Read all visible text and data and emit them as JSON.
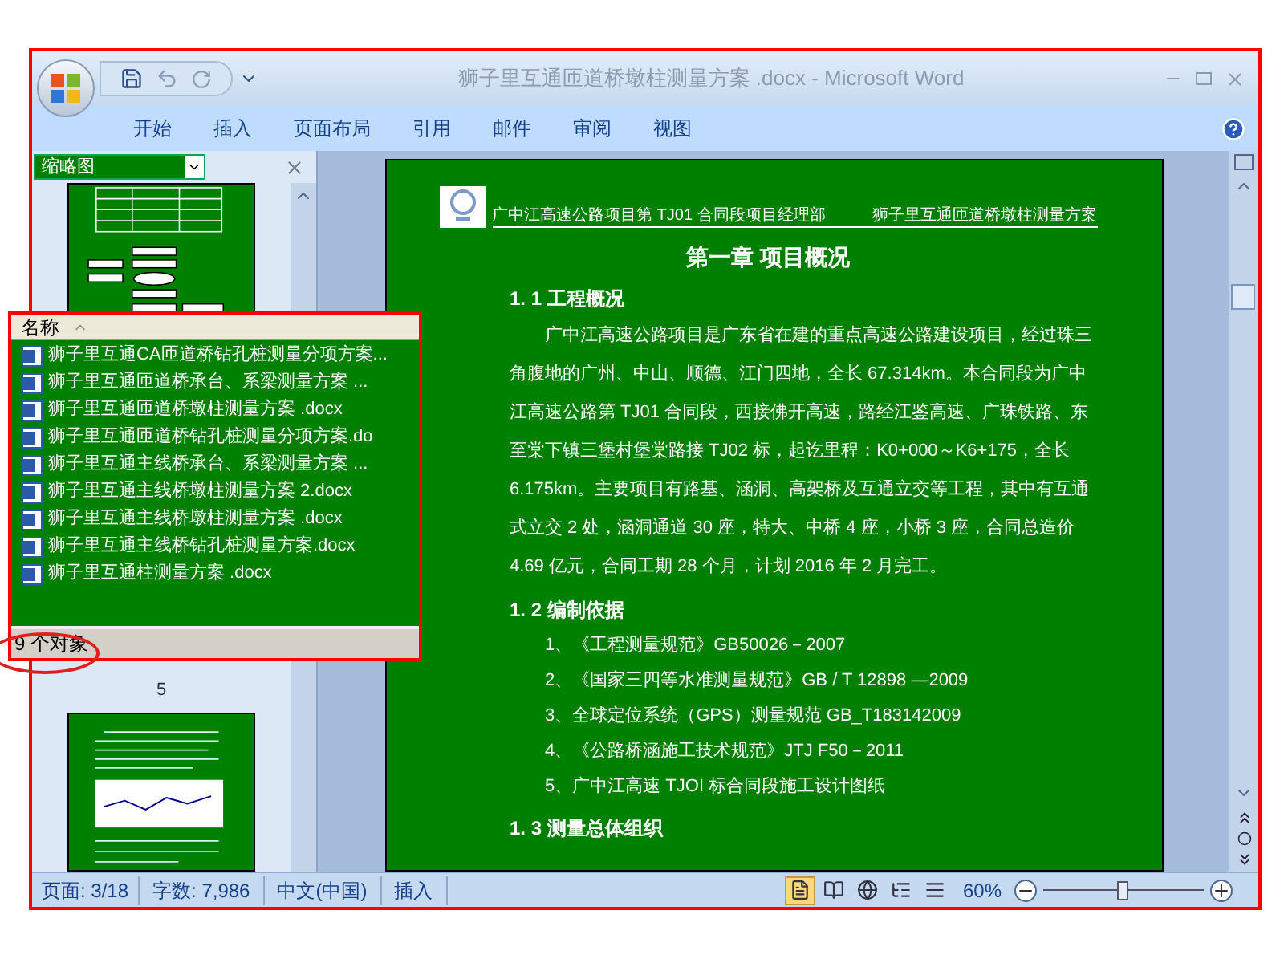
{
  "window": {
    "title": "狮子里互通匝道桥墩柱测量方案 .docx - Microsoft Word"
  },
  "ribbon_tabs": [
    {
      "label": "开始"
    },
    {
      "label": "插入"
    },
    {
      "label": "页面布局"
    },
    {
      "label": "引用"
    },
    {
      "label": "邮件"
    },
    {
      "label": "审阅"
    },
    {
      "label": "视图"
    }
  ],
  "navigation_pane": {
    "title": "缩略图",
    "thumbnail_label": "5"
  },
  "file_list": {
    "column": "名称",
    "files": [
      {
        "name": "狮子里互通CA匝道桥钻孔桩测量分项方案..."
      },
      {
        "name": "狮子里互通匝道桥承台、系梁测量方案 ..."
      },
      {
        "name": "狮子里互通匝道桥墩柱测量方案 .docx"
      },
      {
        "name": "狮子里互通匝道桥钻孔桩测量分项方案.do"
      },
      {
        "name": "狮子里互通主线桥承台、系梁测量方案 ..."
      },
      {
        "name": "狮子里互通主线桥墩柱测量方案 2.docx"
      },
      {
        "name": "狮子里互通主线桥墩柱测量方案 .docx"
      },
      {
        "name": "狮子里互通主线桥钻孔桩测量方案.docx"
      },
      {
        "name": "狮子里互通柱测量方案 .docx"
      }
    ],
    "status": "9 个对象"
  },
  "document": {
    "header_left": "广中江高速公路项目第 TJ01 合同段项目经理部",
    "header_right": "狮子里互通匝道桥墩柱测量方案",
    "title": "第一章  项目概况",
    "sections": [
      {
        "heading": "1. 1 工程概况",
        "paragraphs": [
          "广中江高速公路项目是广东省在建的重点高速公路建设项目，经过珠三角腹地的广州、中山、顺德、江门四地，全长 67.314km。本合同段为广中江高速公路第 TJ01 合同段，西接佛开高速，路经江鉴高速、广珠铁路、东至棠下镇三堡村堡棠路接 TJ02 标，起讫里程：K0+000～K6+175，全长 6.175km。主要项目有路基、涵洞、高架桥及互通立交等工程，其中有互通式立交 2 处，涵洞通道 30 座，特大、中桥 4 座，小桥 3 座，合同总造价 4.69 亿元，合同工期 28 个月，计划 2016 年 2 月完工。"
        ]
      },
      {
        "heading": "1. 2 编制依据",
        "items": [
          "1、《工程测量规范》GB50026－2007",
          "2、《国家三四等水准测量规范》GB  / T 12898 —2009",
          "3、全球定位系统（GPS）测量规范 GB_T183142009",
          "4、《公路桥涵施工技术规范》JTJ F50－2011",
          "5、广中江高速 TJOI 标合同段施工设计图纸"
        ]
      },
      {
        "heading": "1. 3 测量总体组织"
      }
    ]
  },
  "status_bar": {
    "page": "页面: 3/18",
    "words": "字数: 7,986",
    "language": "中文(中国)",
    "mode": "插入",
    "view_buttons": [
      {
        "kind": "print",
        "selected": true
      },
      {
        "kind": "reading",
        "selected": false
      },
      {
        "kind": "web",
        "selected": false
      },
      {
        "kind": "outline",
        "selected": false
      },
      {
        "kind": "draft",
        "selected": false
      }
    ],
    "zoom": "60%",
    "zoom_slider": {
      "level": 0.5
    }
  }
}
